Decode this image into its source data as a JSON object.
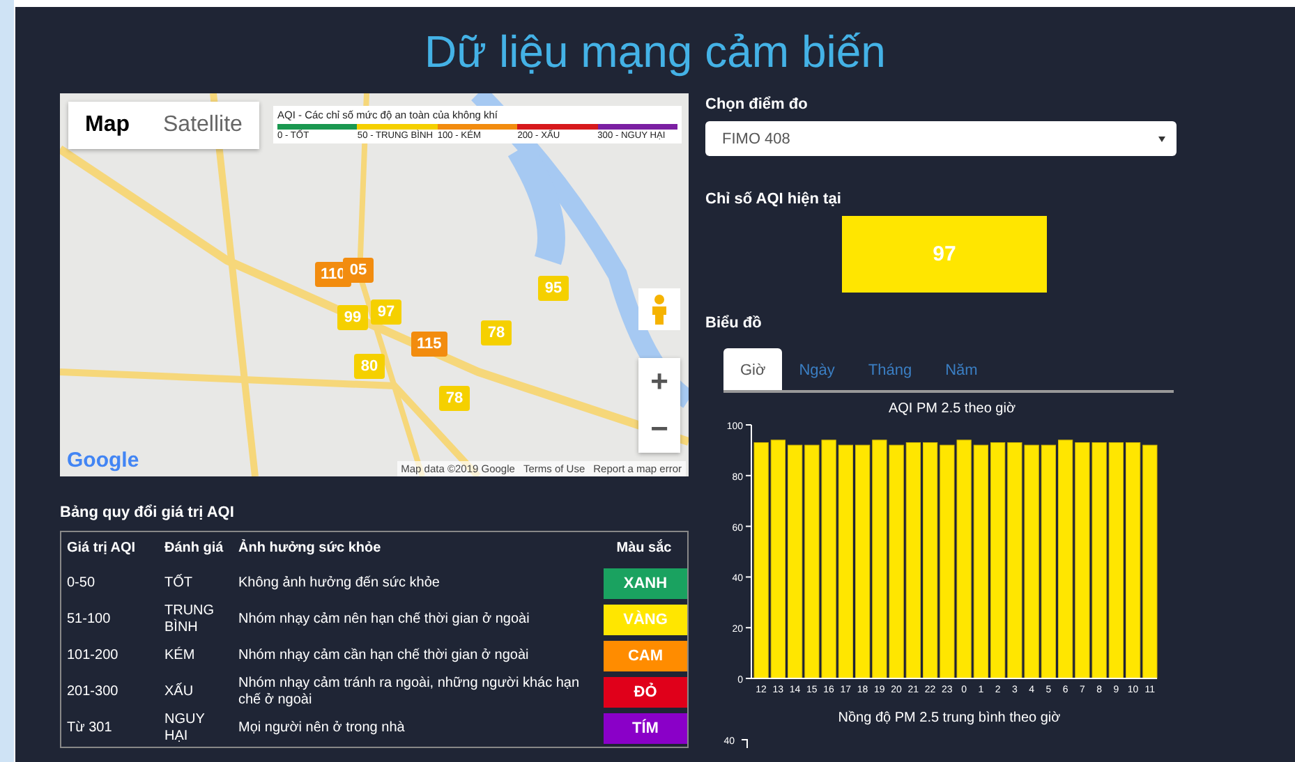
{
  "page": {
    "title": "Dữ liệu mạng cảm biến"
  },
  "map": {
    "map_types": [
      {
        "label": "Map",
        "selected": true
      },
      {
        "label": "Satellite",
        "selected": false
      }
    ],
    "legend": {
      "title": "AQI - Các chỉ số mức độ an toàn của không khí",
      "levels": [
        {
          "label": "0 - TỐT",
          "color": "#1a9850"
        },
        {
          "label": "50 - TRUNG BÌNH",
          "color": "#f5d000"
        },
        {
          "label": "100 - KÉM",
          "color": "#f28c0f"
        },
        {
          "label": "200 - XẤU",
          "color": "#d7191c"
        },
        {
          "label": "300 - NGUY HẠI",
          "color": "#7b1fa2"
        }
      ]
    },
    "markers": [
      {
        "label": "110",
        "color": "#f28c0f"
      },
      {
        "label": "05",
        "color": "#f28c0f"
      },
      {
        "label": "95",
        "color": "#f5d000"
      },
      {
        "label": "99",
        "color": "#f5d000"
      },
      {
        "label": "97",
        "color": "#f5d000"
      },
      {
        "label": "78",
        "color": "#f5d000"
      },
      {
        "label": "115",
        "color": "#f28c0f"
      },
      {
        "label": "80",
        "color": "#f5d000"
      },
      {
        "label": "78",
        "color": "#f5d000"
      }
    ],
    "zoom_in": "+",
    "zoom_out": "−",
    "logo": "Google",
    "attribution": [
      "Map data ©2019 Google",
      "Terms of Use",
      "Report a map error"
    ]
  },
  "conversion_table": {
    "title": "Bảng quy đổi giá trị AQI",
    "columns": [
      "Giá trị AQI",
      "Đánh giá",
      "Ảnh hưởng sức khỏe",
      "Màu sắc"
    ],
    "rows": [
      {
        "range": "0-50",
        "rating": "TỐT",
        "effect": "Không ảnh hưởng đến sức khỏe",
        "color_name": "XANH",
        "color": "#1aa260"
      },
      {
        "range": "51-100",
        "rating": "TRUNG BÌNH",
        "effect": "Nhóm nhạy cảm nên hạn chế thời gian ở ngoài",
        "color_name": "VÀNG",
        "color": "#ffe600"
      },
      {
        "range": "101-200",
        "rating": "KÉM",
        "effect": "Nhóm nhạy cảm cần hạn chế thời gian ở ngoài",
        "color_name": "CAM",
        "color": "#ff8c00"
      },
      {
        "range": "201-300",
        "rating": "XẤU",
        "effect": "Nhóm nhạy cảm tránh ra ngoài, những người khác hạn chế ở ngoài",
        "color_name": "ĐỎ",
        "color": "#e0001a"
      },
      {
        "range": "Từ 301",
        "rating": "NGUY HẠI",
        "effect": "Mọi người nên ở trong nhà",
        "color_name": "TÍM",
        "color": "#8a00c8"
      }
    ]
  },
  "station": {
    "label": "Chọn điểm đo",
    "value": "FIMO 408"
  },
  "current_aqi": {
    "label": "Chỉ số AQI hiện tại",
    "value": "97",
    "color": "#ffe600"
  },
  "charts": {
    "label": "Biểu đồ",
    "tabs": [
      {
        "label": "Giờ",
        "selected": true
      },
      {
        "label": "Ngày",
        "selected": false
      },
      {
        "label": "Tháng",
        "selected": false
      },
      {
        "label": "Năm",
        "selected": false
      }
    ],
    "aqi_chart": {
      "chart_data": {
        "type": "bar",
        "title": "AQI PM 2.5 theo giờ",
        "categories": [
          "12",
          "13",
          "14",
          "15",
          "16",
          "17",
          "18",
          "19",
          "20",
          "21",
          "22",
          "23",
          "0",
          "1",
          "2",
          "3",
          "4",
          "5",
          "6",
          "7",
          "8",
          "9",
          "10",
          "11"
        ],
        "series": [
          {
            "color": "#ffe600",
            "values": [
              93,
              94,
              92,
              92,
              94,
              92,
              92,
              94,
              92,
              93,
              93,
              92,
              94,
              92,
              93,
              93,
              92,
              92,
              94,
              93,
              93,
              93,
              93,
              92
            ]
          }
        ],
        "ylim": [
          0,
          100
        ],
        "yticks": [
          0,
          20,
          40,
          60,
          80,
          100
        ]
      }
    },
    "pm_chart": {
      "title": "Nồng độ PM 2.5 trung bình theo giờ",
      "top_tick": "40"
    }
  }
}
